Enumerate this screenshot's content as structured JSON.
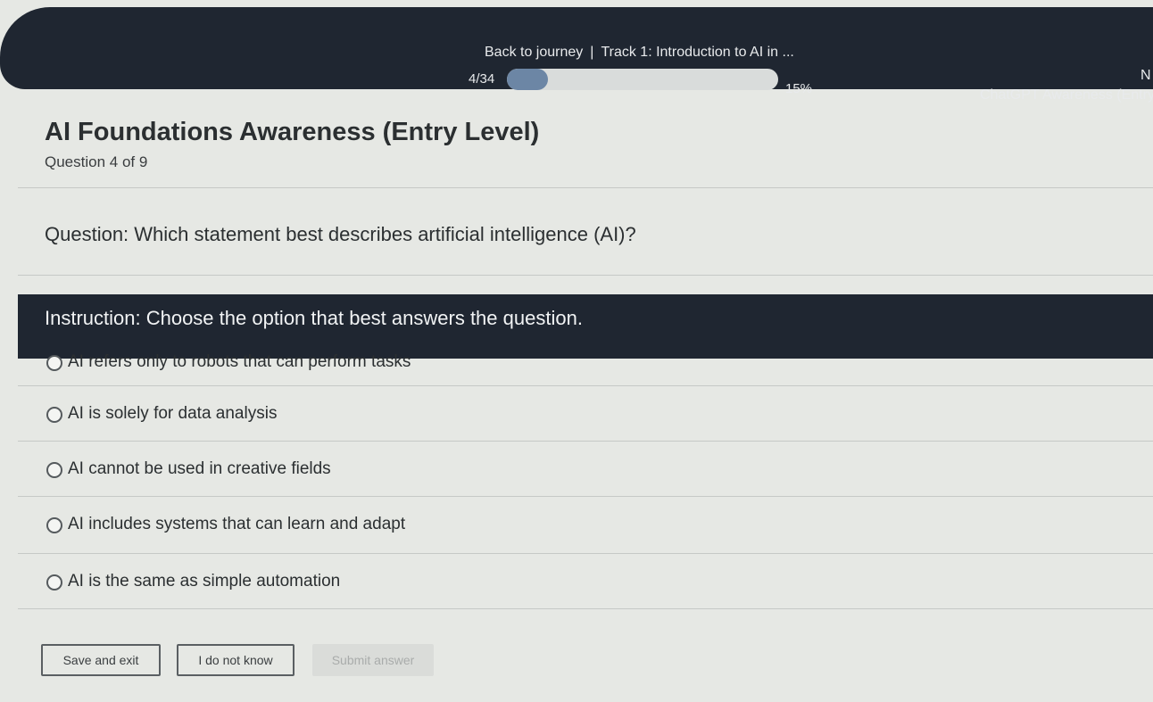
{
  "header": {
    "back_label": "Back to journey",
    "separator": "|",
    "track_title": "Track 1: Introduction to AI in ...",
    "progress_count": "4/34",
    "progress_percent_label": "15%",
    "progress_fraction": 0.15,
    "next_label": "N",
    "next_title": "ChatGPT Awareness (Entry I"
  },
  "quiz": {
    "title": "AI Foundations Awareness (Entry Level)",
    "question_count": "Question 4 of 9",
    "question": "Question: Which statement best describes artificial intelligence (AI)?",
    "instruction": "Instruction: Choose the option that best answers the question.",
    "options": [
      "AI refers only to robots that can perform tasks",
      "AI is solely for data analysis",
      "AI cannot be used in creative fields",
      "AI includes systems that can learn and adapt",
      "AI is the same as simple automation"
    ]
  },
  "actions": {
    "save_label": "Save and exit",
    "dont_know_label": "I do not know",
    "submit_label": "Submit answer"
  },
  "colors": {
    "header_bg": "#1f2631",
    "progress_fill": "#6c86a5",
    "page_bg": "#e6e8e4"
  }
}
